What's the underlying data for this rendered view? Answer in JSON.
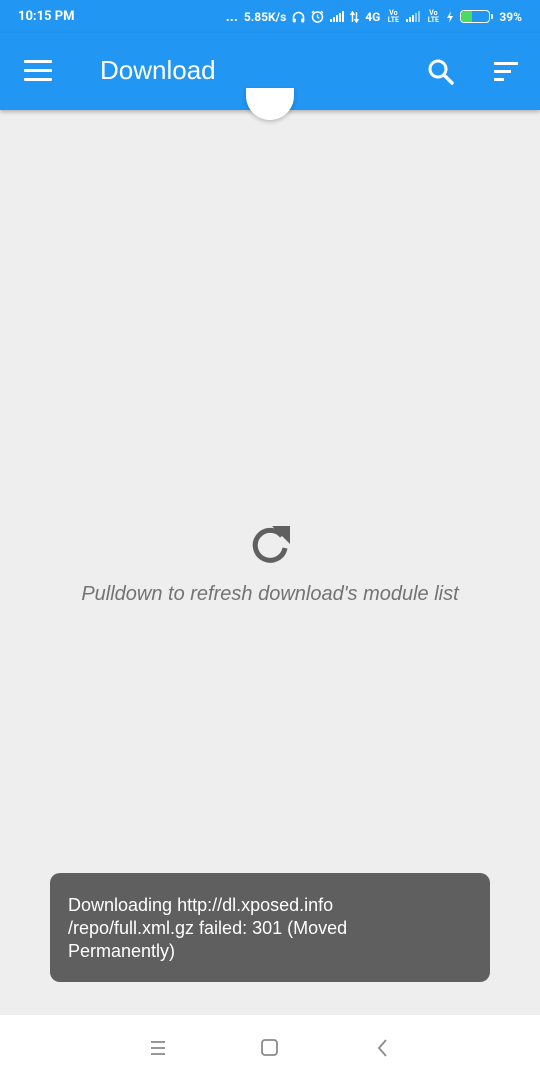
{
  "status_bar": {
    "time": "10:15 PM",
    "dots": "...",
    "speed": "5.85K/s",
    "network": "4G",
    "volte1": "Vo LTE",
    "volte2": "Vo LTE",
    "battery_percent": "39%",
    "battery_level": 0.39,
    "icons": [
      "headphones-icon",
      "alarm-icon",
      "signal-icon",
      "data-arrows-icon",
      "volte-icon",
      "signal-icon",
      "volte-icon",
      "charging-icon",
      "battery-icon"
    ]
  },
  "app_bar": {
    "title": "Download",
    "icons": [
      "menu-icon",
      "search-icon",
      "sort-icon"
    ]
  },
  "content": {
    "empty_message": "Pulldown to refresh download's module list",
    "empty_icon": "refresh-icon"
  },
  "toast": {
    "line1": "Downloading http://dl.xposed.info",
    "line2": "/repo/full.xml.gz failed: 301 (Moved",
    "line3": "Permanently)"
  },
  "nav_bar": {
    "icons": [
      "recents-menu-icon",
      "home-square-icon",
      "back-chevron-icon"
    ]
  },
  "colors": {
    "primary": "#2196f3",
    "background": "#eeeeee",
    "toast": "#5f5f5f",
    "battery_fill": "#4cd964"
  }
}
